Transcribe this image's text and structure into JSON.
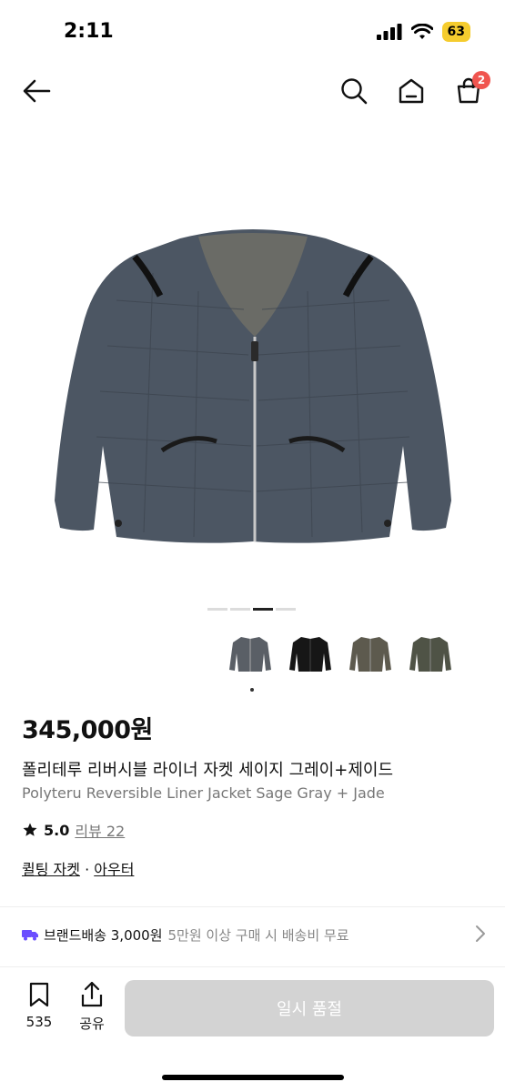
{
  "status": {
    "time": "2:11",
    "battery": "63"
  },
  "nav": {
    "cart_count": "2",
    "icons": [
      "back-arrow-icon",
      "search-icon",
      "home-icon",
      "cart-icon"
    ]
  },
  "product": {
    "price": "345,000원",
    "name_ko": "폴리테루 리버시블 라이너 자켓 세이지 그레이+제이드",
    "name_en": "Polyteru Reversible Liner Jacket Sage Gray + Jade",
    "rating": "5.0",
    "review_label": "리뷰 22",
    "category_main": "퀼팅 자켓",
    "category_sep": "·",
    "category_sub": "아우터",
    "image_count": 4,
    "active_image": 3
  },
  "shipping": {
    "label": "브랜드배송 3,000원",
    "note": "5만원 이상 구매 시 배송비 무료"
  },
  "bottom": {
    "bookmark_count": "535",
    "share_label": "공유",
    "button_label": "일시 품절"
  },
  "colors": {
    "accent_badge": "#f0554f",
    "shipping_icon": "#6b4eff",
    "disabled_button": "#d3d3d3"
  }
}
